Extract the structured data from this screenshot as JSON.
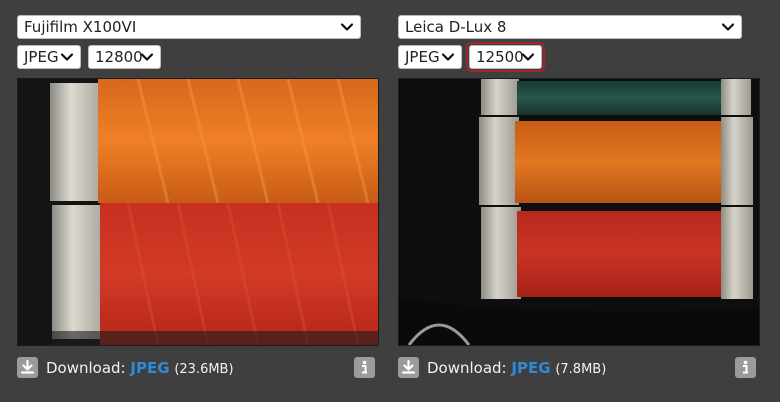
{
  "left": {
    "camera": "Fujifilm X100VI",
    "format": "JPEG",
    "iso": "12800",
    "download_label": "Download:",
    "download_link": "JPEG",
    "download_size": "(23.6MB)"
  },
  "right": {
    "camera": "Leica D-Lux 8",
    "format": "JPEG",
    "iso": "12500",
    "download_label": "Download:",
    "download_link": "JPEG",
    "download_size": "(7.8MB)"
  },
  "colors": {
    "background": "#3f3f3f",
    "link": "#2f8bd6",
    "highlight": "#a3252a",
    "orange_thread": "#e0711f",
    "red_thread": "#c3261f",
    "green_thread": "#1f4a3d"
  },
  "icons": {
    "download": "download-icon",
    "info": "info-icon",
    "dropdown": "chevron-down-icon"
  }
}
